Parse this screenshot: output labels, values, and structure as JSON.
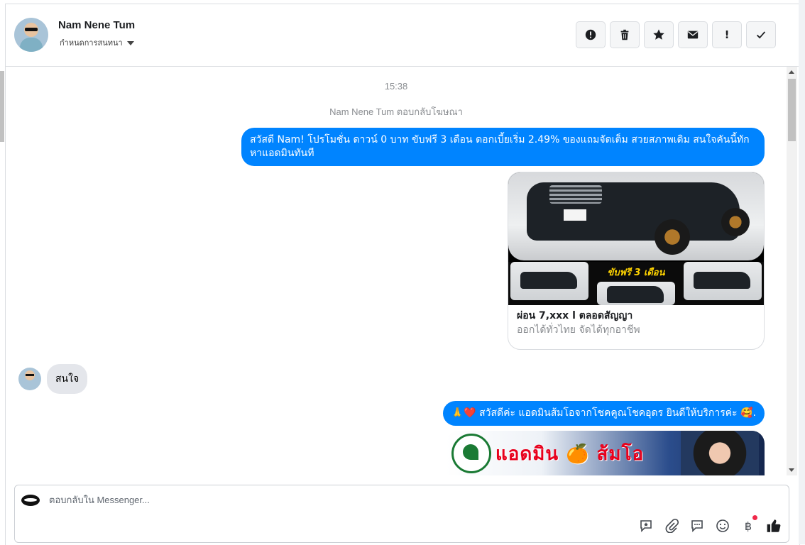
{
  "header": {
    "contact_name": "Nam Nene Tum",
    "status_label": "กำหนดการสนทนา",
    "actions": [
      {
        "name": "report-spam",
        "icon": "alert-circle-icon"
      },
      {
        "name": "delete",
        "icon": "trash-icon"
      },
      {
        "name": "star",
        "icon": "star-icon"
      },
      {
        "name": "mark-unread",
        "icon": "envelope-icon"
      },
      {
        "name": "important",
        "icon": "exclamation-icon"
      },
      {
        "name": "mark-done",
        "icon": "check-icon"
      }
    ],
    "important_glyph": "!"
  },
  "thread": {
    "timestamp": "15:38",
    "reply_note": "Nam Nene Tum ตอบกลับโฆษณา",
    "messages": {
      "out1": "สวัสดี Nam! โปรโมชั่น ดาวน์ 0 บาท ขับฟรี 3 เดือน ดอกเบี้ยเริ่ม 2.49% ของแถมจัดเต็ม สวยสภาพเดิม สนใจคันนี้ทักหาแอดมินทันที",
      "card_promo": "ขับฟรี 3 เดือน",
      "card_title": "ผ่อน 7,xxx l ตลอดสัญญา",
      "card_subtitle": "ออกได้ทั่วไทย จัดได้ทุกอาชีพ",
      "in1": "สนใจ",
      "out2": "🙏❤️ สวัสดีค่ะ แอดมินส้มโอจากโชคคูณโชคอุดร ยินดีให้บริการค่ะ 🥰.",
      "img2_title": "แอดมิน 🍊 ส้มโอ"
    }
  },
  "composer": {
    "placeholder": "ตอบกลับใน Messenger...",
    "tools": [
      "saved-reply-icon",
      "attachment-icon",
      "chat-icon",
      "emoji-icon",
      "baht-payment-icon",
      "like-icon"
    ],
    "baht_glyph": "฿"
  },
  "colors": {
    "outgoing_bubble": "#0084ff",
    "incoming_bubble": "#e4e6eb",
    "notification_dot": "#f02849"
  }
}
